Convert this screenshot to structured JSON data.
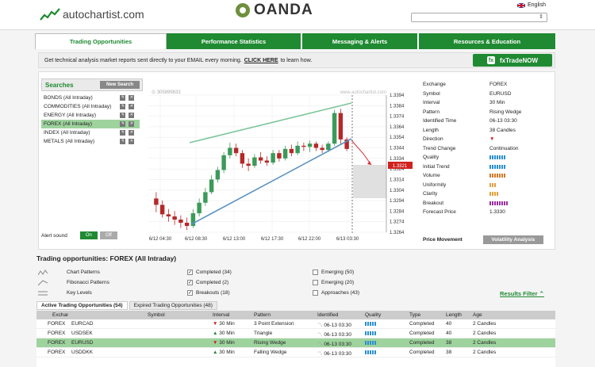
{
  "header": {
    "logo_text": "autochartist.com",
    "partner_text": "OANDA",
    "language": "English",
    "language_select": ""
  },
  "tabs": [
    {
      "label": "Trading Opportunities",
      "active": true
    },
    {
      "label": "Performance Statistics",
      "active": false
    },
    {
      "label": "Messaging & Alerts",
      "active": false
    },
    {
      "label": "Resources & Education",
      "active": false
    }
  ],
  "banner": {
    "text_before": "Get technical analysis market reports sent directly to your EMAIL every morning.",
    "link": "CLICK HERE",
    "text_after": "to learn how.",
    "button": "fxTradeNOW"
  },
  "searches": {
    "title": "Searches",
    "new_button": "New Search",
    "items": [
      {
        "label": "BONDS (All Intraday)",
        "selected": false
      },
      {
        "label": "COMMODITIES (All Intraday)",
        "selected": false
      },
      {
        "label": "ENERGY (All Intraday)",
        "selected": false
      },
      {
        "label": "FOREX (All Intraday)",
        "selected": true
      },
      {
        "label": "INDEX (All Intraday)",
        "selected": false
      },
      {
        "label": "METALS (All Intraday)",
        "selected": false
      }
    ],
    "alert_label": "Alert sound",
    "on": "On",
    "off": "Off"
  },
  "chart": {
    "watermark": "www.autochartist.com",
    "id_label": "305899633",
    "y_ticks": [
      "1.3394",
      "1.3384",
      "1.3374",
      "1.3364",
      "1.3354",
      "1.3344",
      "1.3334",
      "1.3324",
      "1.3314",
      "1.3304",
      "1.3294",
      "1.3284",
      "1.3274",
      "1.3264"
    ],
    "x_ticks": [
      "6/12 04:30",
      "6/12 08:30",
      "6/12 13:00",
      "6/12 17:30",
      "6/12 22:00",
      "6/13 03:30"
    ],
    "price_tag": "1.3321",
    "candles": [
      [
        1.3296,
        1.3302,
        1.3283,
        1.329
      ],
      [
        1.329,
        1.3294,
        1.3278,
        1.3281
      ],
      [
        1.3281,
        1.3286,
        1.3274,
        1.3279
      ],
      [
        1.3279,
        1.3284,
        1.3271,
        1.3276
      ],
      [
        1.3276,
        1.328,
        1.3268,
        1.3273
      ],
      [
        1.3273,
        1.3278,
        1.3266,
        1.327
      ],
      [
        1.327,
        1.3286,
        1.3268,
        1.3282
      ],
      [
        1.3282,
        1.3296,
        1.3279,
        1.3292
      ],
      [
        1.3292,
        1.3306,
        1.3289,
        1.3302
      ],
      [
        1.3302,
        1.3318,
        1.33,
        1.3314
      ],
      [
        1.3314,
        1.3326,
        1.3311,
        1.3323
      ],
      [
        1.3323,
        1.334,
        1.332,
        1.3337
      ],
      [
        1.3337,
        1.3349,
        1.3334,
        1.3344
      ],
      [
        1.3344,
        1.3348,
        1.3336,
        1.3339
      ],
      [
        1.3339,
        1.3342,
        1.3325,
        1.3329
      ],
      [
        1.3329,
        1.3334,
        1.3322,
        1.3327
      ],
      [
        1.3327,
        1.3338,
        1.3325,
        1.3335
      ],
      [
        1.3335,
        1.334,
        1.3329,
        1.3332
      ],
      [
        1.3332,
        1.3336,
        1.3327,
        1.333
      ],
      [
        1.333,
        1.3342,
        1.3328,
        1.3339
      ],
      [
        1.3339,
        1.3342,
        1.3331,
        1.3334
      ],
      [
        1.3334,
        1.3346,
        1.3332,
        1.3343
      ],
      [
        1.3343,
        1.3347,
        1.3336,
        1.3339
      ],
      [
        1.3339,
        1.335,
        1.3337,
        1.3346
      ],
      [
        1.3346,
        1.3349,
        1.3341,
        1.3345
      ],
      [
        1.3345,
        1.3351,
        1.334,
        1.3348
      ],
      [
        1.3348,
        1.335,
        1.3341,
        1.3344
      ],
      [
        1.3344,
        1.3347,
        1.3339,
        1.3342
      ],
      [
        1.3342,
        1.335,
        1.334,
        1.3348
      ],
      [
        1.3348,
        1.338,
        1.3346,
        1.3377
      ],
      [
        1.3377,
        1.3381,
        1.3347,
        1.3352
      ],
      [
        1.3352,
        1.3354,
        1.3341,
        1.3343
      ]
    ]
  },
  "info": {
    "rows": [
      {
        "k": "Exchange",
        "v": "FOREX"
      },
      {
        "k": "Symbol",
        "v": "EURUSD"
      },
      {
        "k": "Interval",
        "v": "30 Min"
      },
      {
        "k": "Pattern",
        "v": "Rising Wedge"
      },
      {
        "k": "Identified Time",
        "v": "06-13 03:30"
      },
      {
        "k": "Length",
        "v": "38 Candles"
      },
      {
        "k": "Direction",
        "v": ""
      },
      {
        "k": "Trend Change",
        "v": "Continuation"
      },
      {
        "k": "Quality",
        "v": ""
      },
      {
        "k": "Initial Trend",
        "v": ""
      },
      {
        "k": "Volume",
        "v": ""
      },
      {
        "k": "Uniformity",
        "v": ""
      },
      {
        "k": "Clarity",
        "v": ""
      },
      {
        "k": "Breakout",
        "v": ""
      },
      {
        "k": "Forecast Price",
        "v": "1.3330"
      }
    ],
    "bar_levels": {
      "Quality": 7,
      "Initial Trend": 7,
      "Volume": 7,
      "Uniformity": 3,
      "Clarity": 4,
      "Breakout": 8
    },
    "bar_colors": {
      "Quality": "#2a8fd0",
      "Initial Trend": "#2a8fd0",
      "Volume": "#d07a2a",
      "Uniformity": "#e0a040",
      "Clarity": "#e0a040",
      "Breakout": "#9a2fa0"
    },
    "price_movement": "Price Movement",
    "volatility_button": "Volatility Analysis"
  },
  "opportunities": {
    "title": "Trading opportunities: FOREX (All Intraday)",
    "types": [
      "Chart Patterns",
      "Fibonacci Patterns",
      "Key Levels"
    ],
    "completed": [
      "Completed (34)",
      "Completed (2)",
      "Breakouts (18)"
    ],
    "emerging": [
      "Emerging (50)",
      "Emerging (20)",
      "Approaches (43)"
    ],
    "results_filter": "Results Filter"
  },
  "table": {
    "tabs": [
      "Active Trading Opportunities (54)",
      "Expired Trading Opportunities (48)"
    ],
    "headers": [
      "Exchange",
      "Symbol",
      "Interval",
      "Pattern",
      "Identified",
      "Quality",
      "Type",
      "Length",
      "Age"
    ],
    "rows": [
      {
        "exchange": "FOREX",
        "symbol": "EURCAD",
        "dir": "down",
        "interval": "30 Min",
        "pattern": "3 Point Extension",
        "identified": "06-13 03:30",
        "type": "Completed",
        "length": "40",
        "age": "2 Candles",
        "selected": false
      },
      {
        "exchange": "FOREX",
        "symbol": "USDSEK",
        "dir": "up",
        "interval": "30 Min",
        "pattern": "Triangle",
        "identified": "06-13 03:30",
        "type": "Completed",
        "length": "40",
        "age": "2 Candles",
        "selected": false
      },
      {
        "exchange": "FOREX",
        "symbol": "EURUSD",
        "dir": "down",
        "interval": "30 Min",
        "pattern": "Rising Wedge",
        "identified": "06-13 03:30",
        "type": "Completed",
        "length": "38",
        "age": "2 Candles",
        "selected": true
      },
      {
        "exchange": "FOREX",
        "symbol": "USDDKK",
        "dir": "up",
        "interval": "30 Min",
        "pattern": "Falling Wedge",
        "identified": "06-13 03:30",
        "type": "Completed",
        "length": "38",
        "age": "2 Candles",
        "selected": false
      }
    ]
  }
}
